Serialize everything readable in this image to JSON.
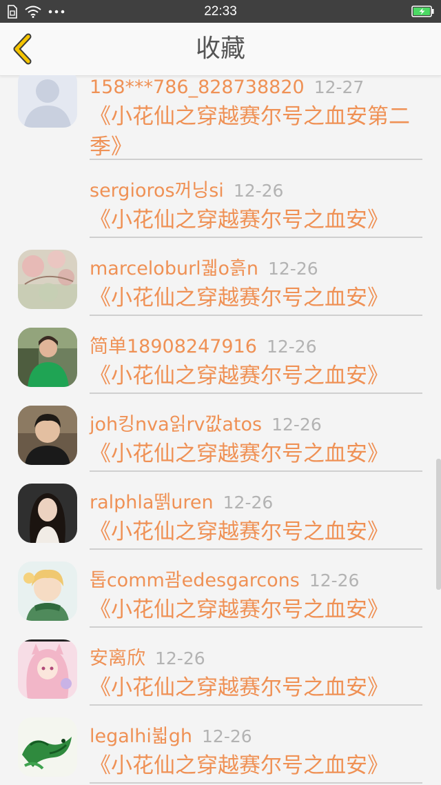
{
  "status_bar": {
    "time": "22:33",
    "icons": [
      "sim-icon",
      "wifi-icon",
      "more-dots-icon",
      "battery-charging-icon"
    ]
  },
  "nav": {
    "title": "收藏",
    "back_icon": "chevron-left-icon",
    "accent_color": "#f5c400"
  },
  "items": [
    {
      "name": "158***786_828738820",
      "date": "12-27",
      "title": "《小花仙之穿越赛尔号之血安第二季》",
      "avatar": "default-avatar"
    },
    {
      "name": "sergioros꺼닝si",
      "date": "12-26",
      "title": "《小花仙之穿越赛尔号之血安》",
      "avatar": ""
    },
    {
      "name": "marceloburl궯o흙n",
      "date": "12-26",
      "title": "《小花仙之穿越赛尔号之血安》",
      "avatar": "blossom-painting-avatar"
    },
    {
      "name": "简单18908247916",
      "date": "12-26",
      "title": "《小花仙之穿越赛尔号之血安》",
      "avatar": "woman-green-shirt-avatar"
    },
    {
      "name": "joh킹nva읽rv깞atos",
      "date": "12-26",
      "title": "《小花仙之穿越赛尔号之血安》",
      "avatar": "man-portrait-avatar"
    },
    {
      "name": "ralphla뗅uren",
      "date": "12-26",
      "title": "《小花仙之穿越赛尔号之血安》",
      "avatar": "woman-dark-hair-avatar"
    },
    {
      "name": "톱comm괌edesgarcons",
      "date": "12-26",
      "title": "《小花仙之穿越赛尔号之血安》",
      "avatar": "anime-boy-avatar"
    },
    {
      "name": "安离欣",
      "date": "12-26",
      "title": "《小花仙之穿越赛尔号之血安》",
      "avatar": "anime-girl-pink-avatar"
    },
    {
      "name": "legalhi뷟gh",
      "date": "12-26",
      "title": "《小花仙之穿越赛尔号之血安》",
      "avatar": "green-dragon-avatar"
    }
  ],
  "colors": {
    "name_text": "#ef9155",
    "date_text": "#b3b3b3",
    "status_bar": "#404040",
    "battery": "#4cd964"
  }
}
